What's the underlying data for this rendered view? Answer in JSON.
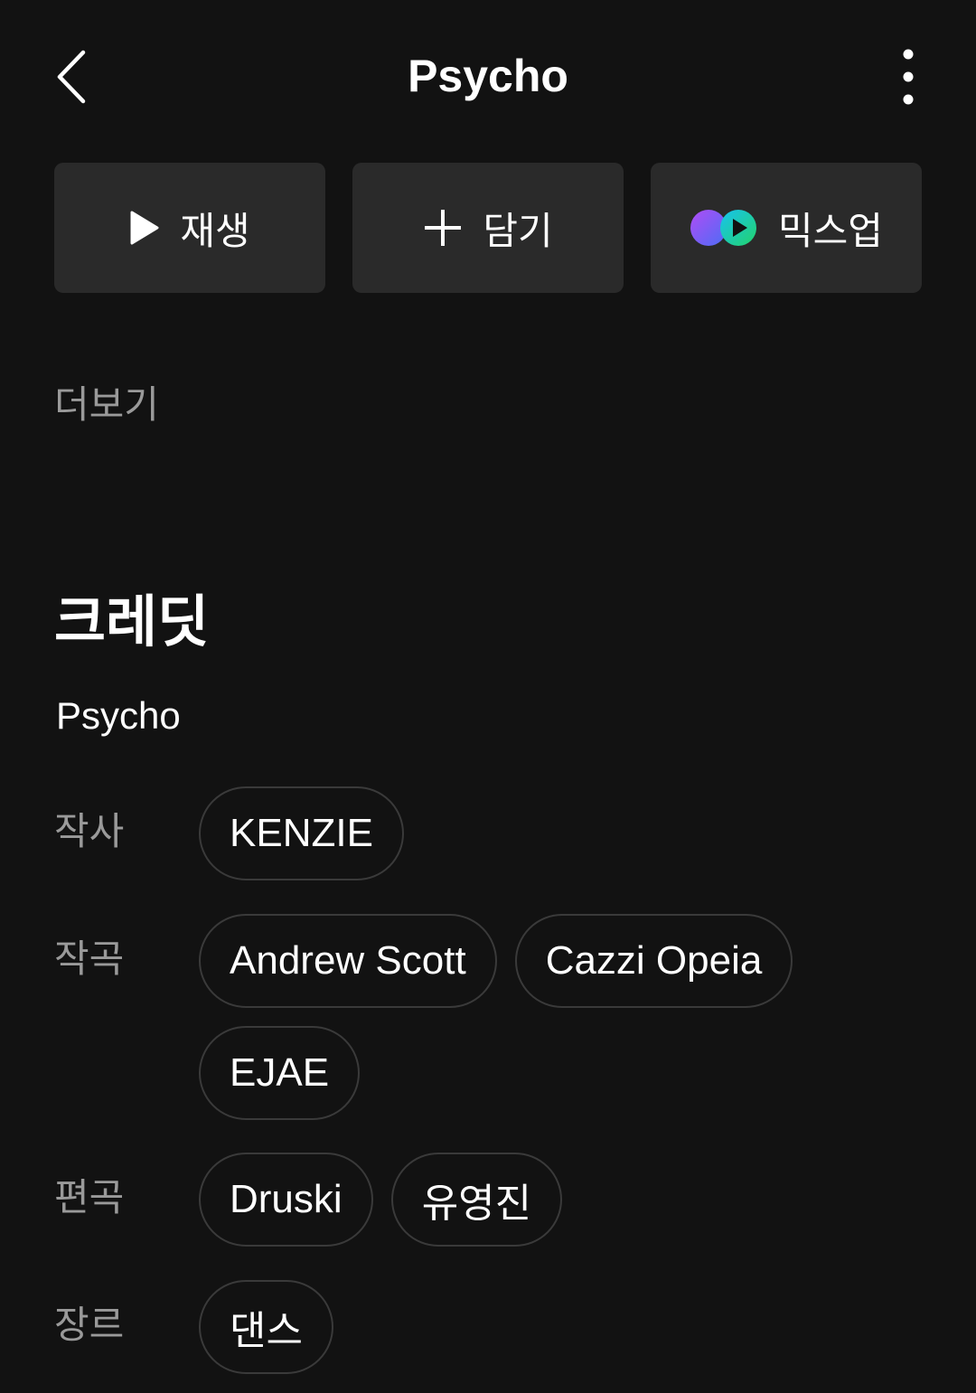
{
  "header": {
    "title": "Psycho",
    "back_icon": "chevron-left-icon",
    "more_icon": "more-vertical-icon"
  },
  "actions": {
    "play_label": "재생",
    "add_label": "담기",
    "mixup_label": "믹스업"
  },
  "more_text": "더보기",
  "credits": {
    "heading": "크레딧",
    "song_name": "Psycho",
    "lyricist": {
      "label": "작사",
      "names": [
        "KENZIE"
      ]
    },
    "composer": {
      "label": "작곡",
      "names": [
        "Andrew Scott",
        "Cazzi Opeia",
        "EJAE"
      ]
    },
    "arranger": {
      "label": "편곡",
      "names": [
        "Druski",
        "유영진"
      ]
    },
    "genre": {
      "label": "장르",
      "names": [
        "댄스"
      ]
    }
  },
  "colors": {
    "background": "#121212",
    "button_bg": "#2a2a2a",
    "chip_border": "#3a3a3a",
    "muted_text": "#9a9a9a",
    "mixup_purple": "#8a5cf5",
    "mixup_green": "#22d36b"
  }
}
